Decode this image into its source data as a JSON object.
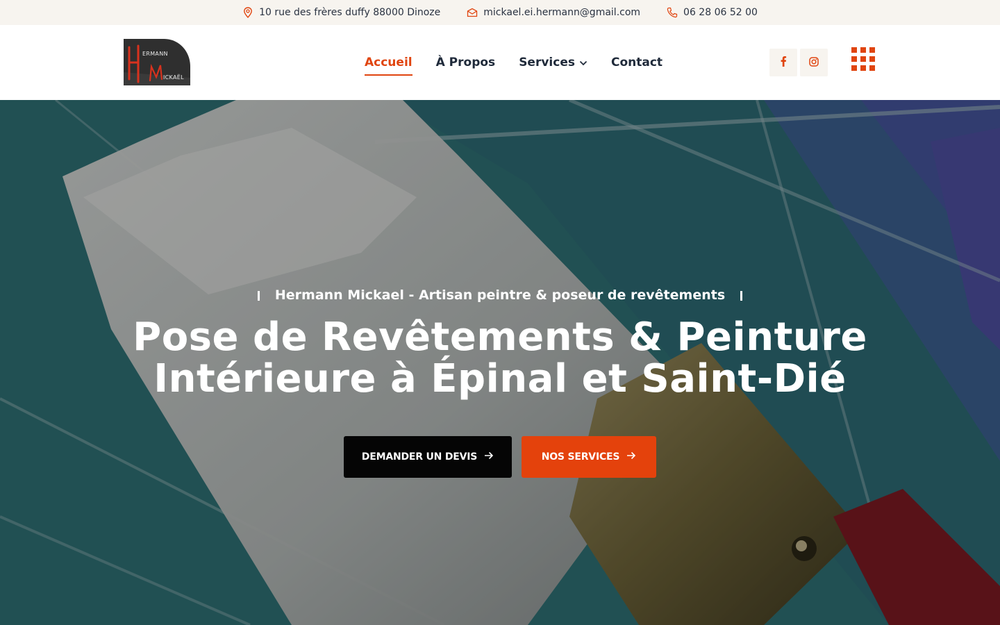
{
  "topbar": {
    "address": "10 rue des frères duffy 88000 Dinoze",
    "email": "mickael.ei.hermann@gmail.com",
    "phone": "06 28 06 52 00",
    "icons": [
      "map-pin-icon",
      "mail-icon",
      "phone-icon"
    ]
  },
  "header": {
    "logo": {
      "big_letters": "HM",
      "line1": "ERMANN",
      "line2": "ICKAËL"
    },
    "nav": [
      {
        "label": "Accueil",
        "active": true
      },
      {
        "label": "À Propos",
        "active": false
      },
      {
        "label": "Services",
        "active": false,
        "dropdown": true
      },
      {
        "label": "Contact",
        "active": false
      }
    ],
    "social": [
      "facebook-icon",
      "instagram-icon"
    ]
  },
  "hero": {
    "eyebrow": "Hermann Mickael - Artisan peintre & poseur de revêtements",
    "title_line1": "Pose de Revêtements & Peinture",
    "title_line2": "Intérieure à Épinal et Saint-Dié",
    "cta_primary": "DEMANDER UN DEVIS",
    "cta_secondary": "NOS SERVICES"
  },
  "colors": {
    "accent": "#e04510",
    "topbar_bg": "#f7f4ef",
    "text": "#1f2a3a",
    "button_dark": "#050505"
  }
}
